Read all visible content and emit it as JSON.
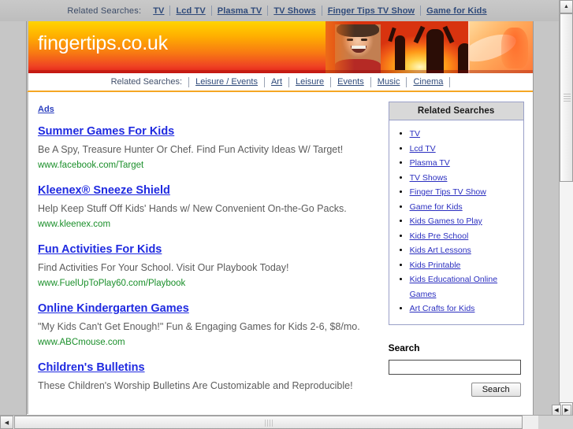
{
  "top_strip": {
    "label": "Related Searches:",
    "links": [
      "TV",
      "Lcd TV",
      "Plasma TV",
      "TV Shows",
      "Finger Tips TV Show",
      "Game for Kids"
    ]
  },
  "banner": {
    "brand": "fingertips.co.uk",
    "accent_start": "#ffd400",
    "accent_end": "#e21f18"
  },
  "nav": {
    "label": "Related Searches:",
    "links": [
      "Leisure / Events",
      "Art",
      "Leisure",
      "Events",
      "Music",
      "Cinema"
    ]
  },
  "ads": {
    "heading": "Ads",
    "items": [
      {
        "title": "Summer Games For Kids",
        "desc": "Be A Spy, Treasure Hunter Or Chef. Find Fun Activity Ideas W/ Target!",
        "url": "www.facebook.com/Target"
      },
      {
        "title": "Kleenex® Sneeze Shield",
        "desc": "Help Keep Stuff Off Kids' Hands w/ New Convenient On-the-Go Packs.",
        "url": "www.kleenex.com"
      },
      {
        "title": "Fun Activities For Kids",
        "desc": "Find Activities For Your School. Visit Our Playbook Today!",
        "url": "www.FuelUpToPlay60.com/Playbook"
      },
      {
        "title": "Online Kindergarten Games",
        "desc": "\"My Kids Can't Get Enough!\" Fun & Engaging Games for Kids 2-6, $8/mo.",
        "url": "www.ABCmouse.com"
      },
      {
        "title": "Children's Bulletins",
        "desc": "These Children's Worship Bulletins Are Customizable and Reproducible!",
        "url": ""
      }
    ]
  },
  "related_searches_box": {
    "heading": "Related Searches",
    "items": [
      "TV",
      "Lcd TV",
      "Plasma TV",
      "TV Shows",
      "Finger Tips TV Show",
      "Game for Kids",
      "Kids Games to Play",
      "Kids Pre School",
      "Kids Art Lessons",
      "Kids Printable",
      "Kids Educational Online Games",
      "Art Crafts for Kids"
    ]
  },
  "search": {
    "title": "Search",
    "value": "",
    "placeholder": "",
    "button": "Search"
  },
  "scrollbars": {
    "up_arrow": "▲",
    "down_arrow": "▼",
    "left_arrow": "◀",
    "right_arrow": "▶"
  }
}
